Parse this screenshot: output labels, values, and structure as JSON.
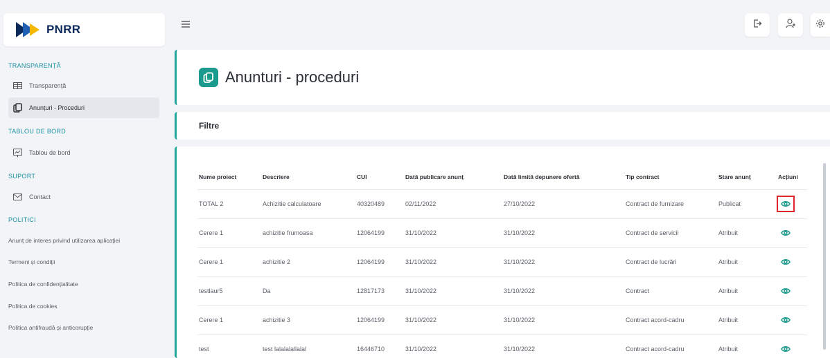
{
  "brand": {
    "name": "PNRR"
  },
  "sidebar": {
    "sections": [
      {
        "title": "TRANSPARENȚĂ"
      },
      {
        "title": "TABLOU DE BORD"
      },
      {
        "title": "SUPORT"
      },
      {
        "title": "POLITICI"
      }
    ],
    "items": [
      {
        "label": "Transparență",
        "icon": "table-icon"
      },
      {
        "label": "Anunțuri - Proceduri",
        "icon": "copy-icon"
      },
      {
        "label": "Tablou de bord",
        "icon": "dashboard-icon"
      },
      {
        "label": "Contact",
        "icon": "mail-icon"
      }
    ],
    "policies": [
      "Anunț de interes privind utilizarea aplicației",
      "Termeni și condiții",
      "Politica de confidențialitate",
      "Politica de cookies",
      "Politica antifraudă și anticorupție"
    ]
  },
  "topbar": {
    "menu_icon": "hamburger-icon",
    "buttons": [
      "logout-icon",
      "add-user-icon",
      "settings-icon"
    ]
  },
  "page": {
    "title": "Anunturi - proceduri"
  },
  "filters": {
    "title": "Filtre"
  },
  "table": {
    "headers": [
      "Nume proiect",
      "Descriere",
      "CUI",
      "Dată publicare anunț",
      "Dată limită depunere ofertă",
      "Tip contract",
      "Stare anunț",
      "Acțiuni"
    ],
    "rows": [
      [
        "TOTAL 2",
        "Achizitie calculatoare",
        "40320489",
        "02/11/2022",
        "27/10/2022",
        "Contract de furnizare",
        "Publicat"
      ],
      [
        "Cerere 1",
        "achizitie frumoasa",
        "12064199",
        "31/10/2022",
        "31/10/2022",
        "Contract de servicii",
        "Atribuit"
      ],
      [
        "Cerere 1",
        "achizitie 2",
        "12064199",
        "31/10/2022",
        "31/10/2022",
        "Contract de lucrări",
        "Atribuit"
      ],
      [
        "testlaur5",
        "Da",
        "12817173",
        "31/10/2022",
        "31/10/2022",
        "Contract",
        "Atribuit"
      ],
      [
        "Cerere 1",
        "achizitie 3",
        "12064199",
        "31/10/2022",
        "31/10/2022",
        "Contract acord-cadru",
        "Atribuit"
      ],
      [
        "test",
        "test lalalalallalal",
        "16446710",
        "31/10/2022",
        "31/10/2022",
        "Contract acord-cadru",
        "Atribuit"
      ]
    ]
  },
  "colors": {
    "accent": "#1a9b8d",
    "highlight": "#e0242b",
    "section": "#1a8fa0"
  }
}
